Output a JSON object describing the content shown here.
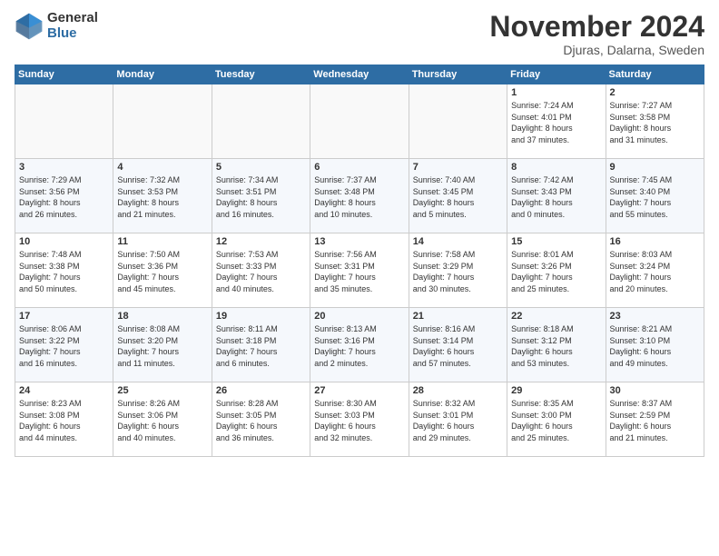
{
  "header": {
    "logo_general": "General",
    "logo_blue": "Blue",
    "month_title": "November 2024",
    "location": "Djuras, Dalarna, Sweden"
  },
  "weekdays": [
    "Sunday",
    "Monday",
    "Tuesday",
    "Wednesday",
    "Thursday",
    "Friday",
    "Saturday"
  ],
  "weeks": [
    [
      {
        "day": "",
        "info": ""
      },
      {
        "day": "",
        "info": ""
      },
      {
        "day": "",
        "info": ""
      },
      {
        "day": "",
        "info": ""
      },
      {
        "day": "",
        "info": ""
      },
      {
        "day": "1",
        "info": "Sunrise: 7:24 AM\nSunset: 4:01 PM\nDaylight: 8 hours\nand 37 minutes."
      },
      {
        "day": "2",
        "info": "Sunrise: 7:27 AM\nSunset: 3:58 PM\nDaylight: 8 hours\nand 31 minutes."
      }
    ],
    [
      {
        "day": "3",
        "info": "Sunrise: 7:29 AM\nSunset: 3:56 PM\nDaylight: 8 hours\nand 26 minutes."
      },
      {
        "day": "4",
        "info": "Sunrise: 7:32 AM\nSunset: 3:53 PM\nDaylight: 8 hours\nand 21 minutes."
      },
      {
        "day": "5",
        "info": "Sunrise: 7:34 AM\nSunset: 3:51 PM\nDaylight: 8 hours\nand 16 minutes."
      },
      {
        "day": "6",
        "info": "Sunrise: 7:37 AM\nSunset: 3:48 PM\nDaylight: 8 hours\nand 10 minutes."
      },
      {
        "day": "7",
        "info": "Sunrise: 7:40 AM\nSunset: 3:45 PM\nDaylight: 8 hours\nand 5 minutes."
      },
      {
        "day": "8",
        "info": "Sunrise: 7:42 AM\nSunset: 3:43 PM\nDaylight: 8 hours\nand 0 minutes."
      },
      {
        "day": "9",
        "info": "Sunrise: 7:45 AM\nSunset: 3:40 PM\nDaylight: 7 hours\nand 55 minutes."
      }
    ],
    [
      {
        "day": "10",
        "info": "Sunrise: 7:48 AM\nSunset: 3:38 PM\nDaylight: 7 hours\nand 50 minutes."
      },
      {
        "day": "11",
        "info": "Sunrise: 7:50 AM\nSunset: 3:36 PM\nDaylight: 7 hours\nand 45 minutes."
      },
      {
        "day": "12",
        "info": "Sunrise: 7:53 AM\nSunset: 3:33 PM\nDaylight: 7 hours\nand 40 minutes."
      },
      {
        "day": "13",
        "info": "Sunrise: 7:56 AM\nSunset: 3:31 PM\nDaylight: 7 hours\nand 35 minutes."
      },
      {
        "day": "14",
        "info": "Sunrise: 7:58 AM\nSunset: 3:29 PM\nDaylight: 7 hours\nand 30 minutes."
      },
      {
        "day": "15",
        "info": "Sunrise: 8:01 AM\nSunset: 3:26 PM\nDaylight: 7 hours\nand 25 minutes."
      },
      {
        "day": "16",
        "info": "Sunrise: 8:03 AM\nSunset: 3:24 PM\nDaylight: 7 hours\nand 20 minutes."
      }
    ],
    [
      {
        "day": "17",
        "info": "Sunrise: 8:06 AM\nSunset: 3:22 PM\nDaylight: 7 hours\nand 16 minutes."
      },
      {
        "day": "18",
        "info": "Sunrise: 8:08 AM\nSunset: 3:20 PM\nDaylight: 7 hours\nand 11 minutes."
      },
      {
        "day": "19",
        "info": "Sunrise: 8:11 AM\nSunset: 3:18 PM\nDaylight: 7 hours\nand 6 minutes."
      },
      {
        "day": "20",
        "info": "Sunrise: 8:13 AM\nSunset: 3:16 PM\nDaylight: 7 hours\nand 2 minutes."
      },
      {
        "day": "21",
        "info": "Sunrise: 8:16 AM\nSunset: 3:14 PM\nDaylight: 6 hours\nand 57 minutes."
      },
      {
        "day": "22",
        "info": "Sunrise: 8:18 AM\nSunset: 3:12 PM\nDaylight: 6 hours\nand 53 minutes."
      },
      {
        "day": "23",
        "info": "Sunrise: 8:21 AM\nSunset: 3:10 PM\nDaylight: 6 hours\nand 49 minutes."
      }
    ],
    [
      {
        "day": "24",
        "info": "Sunrise: 8:23 AM\nSunset: 3:08 PM\nDaylight: 6 hours\nand 44 minutes."
      },
      {
        "day": "25",
        "info": "Sunrise: 8:26 AM\nSunset: 3:06 PM\nDaylight: 6 hours\nand 40 minutes."
      },
      {
        "day": "26",
        "info": "Sunrise: 8:28 AM\nSunset: 3:05 PM\nDaylight: 6 hours\nand 36 minutes."
      },
      {
        "day": "27",
        "info": "Sunrise: 8:30 AM\nSunset: 3:03 PM\nDaylight: 6 hours\nand 32 minutes."
      },
      {
        "day": "28",
        "info": "Sunrise: 8:32 AM\nSunset: 3:01 PM\nDaylight: 6 hours\nand 29 minutes."
      },
      {
        "day": "29",
        "info": "Sunrise: 8:35 AM\nSunset: 3:00 PM\nDaylight: 6 hours\nand 25 minutes."
      },
      {
        "day": "30",
        "info": "Sunrise: 8:37 AM\nSunset: 2:59 PM\nDaylight: 6 hours\nand 21 minutes."
      }
    ]
  ]
}
